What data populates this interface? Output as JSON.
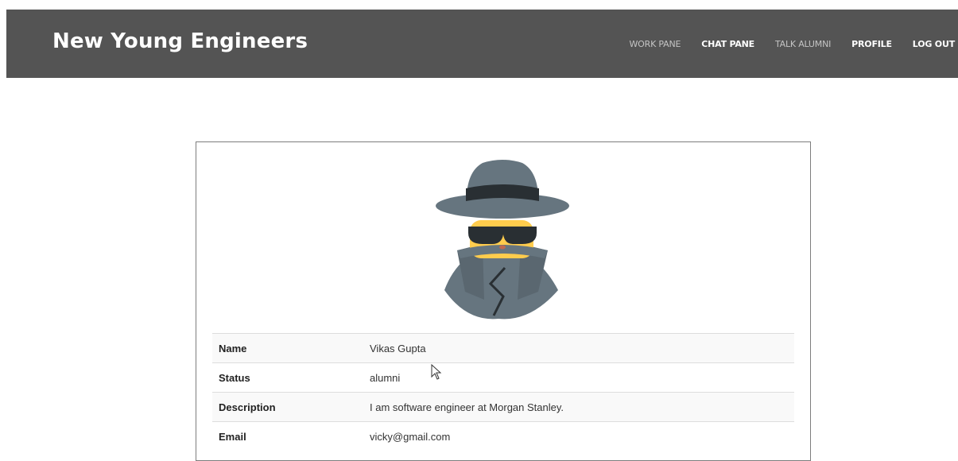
{
  "navbar": {
    "brand": "New Young Engineers",
    "links": [
      {
        "label": "WORK PANE",
        "style": "dim"
      },
      {
        "label": "CHAT PANE",
        "style": "bright"
      },
      {
        "label": "TALK ALUMNI",
        "style": "dim"
      },
      {
        "label": "PROFILE",
        "style": "bright"
      },
      {
        "label": "LOG OUT",
        "style": "bright"
      }
    ]
  },
  "profile": {
    "avatar_icon": "spy-detective-icon",
    "rows": [
      {
        "key": "Name",
        "value": "Vikas Gupta"
      },
      {
        "key": "Status",
        "value": "alumni"
      },
      {
        "key": "Description",
        "value": "I am software engineer at Morgan Stanley."
      },
      {
        "key": "Email",
        "value": "vicky@gmail.com"
      }
    ]
  },
  "colors": {
    "navbar_bg": "#545454",
    "nav_dim": "#c4c4c4",
    "nav_bright": "#ffffff"
  }
}
